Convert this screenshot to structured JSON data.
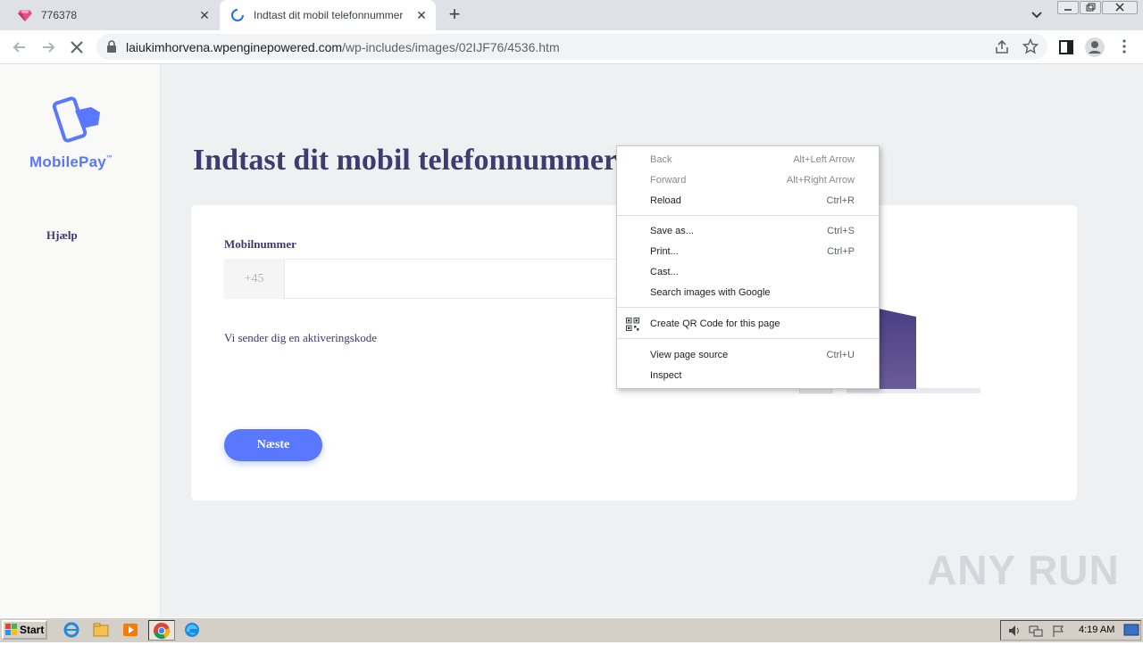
{
  "browser": {
    "tabs": [
      {
        "title": "776378",
        "active": false
      },
      {
        "title": "Indtast dit mobil telefonnummer",
        "active": true
      }
    ],
    "url_host": "laiukimhorvena.wpenginepowered.com",
    "url_path": "/wp-includes/images/02IJF76/4536.htm"
  },
  "sidebar": {
    "logo_text": "MobilePay",
    "logo_tm": "™",
    "help_label": "Hjælp"
  },
  "main": {
    "title": "Indtast dit mobil telefonnummer",
    "phone_label": "Mobilnummer",
    "phone_prefix": "+45",
    "phone_value": "",
    "info_text": "Vi sender dig en aktiveringskode",
    "next_label": "Næste"
  },
  "context_menu": {
    "items": [
      {
        "label": "Back",
        "shortcut": "Alt+Left Arrow",
        "disabled": true
      },
      {
        "label": "Forward",
        "shortcut": "Alt+Right Arrow",
        "disabled": true
      },
      {
        "label": "Reload",
        "shortcut": "Ctrl+R",
        "disabled": false
      },
      {
        "label": "Save as...",
        "shortcut": "Ctrl+S",
        "disabled": false
      },
      {
        "label": "Print...",
        "shortcut": "Ctrl+P",
        "disabled": false
      },
      {
        "label": "Cast...",
        "shortcut": "",
        "disabled": false
      },
      {
        "label": "Search images with Google",
        "shortcut": "",
        "disabled": false
      },
      {
        "label": "Create QR Code for this page",
        "shortcut": "",
        "disabled": false
      },
      {
        "label": "View page source",
        "shortcut": "Ctrl+U",
        "disabled": false
      },
      {
        "label": "Inspect",
        "shortcut": "",
        "disabled": false
      }
    ]
  },
  "watermark": "ANY RUN",
  "taskbar": {
    "start_label": "Start",
    "clock": "4:19 AM"
  },
  "colors": {
    "brand": "#5a78ff",
    "title": "#403a70",
    "page_bg": "#eef0f1"
  }
}
